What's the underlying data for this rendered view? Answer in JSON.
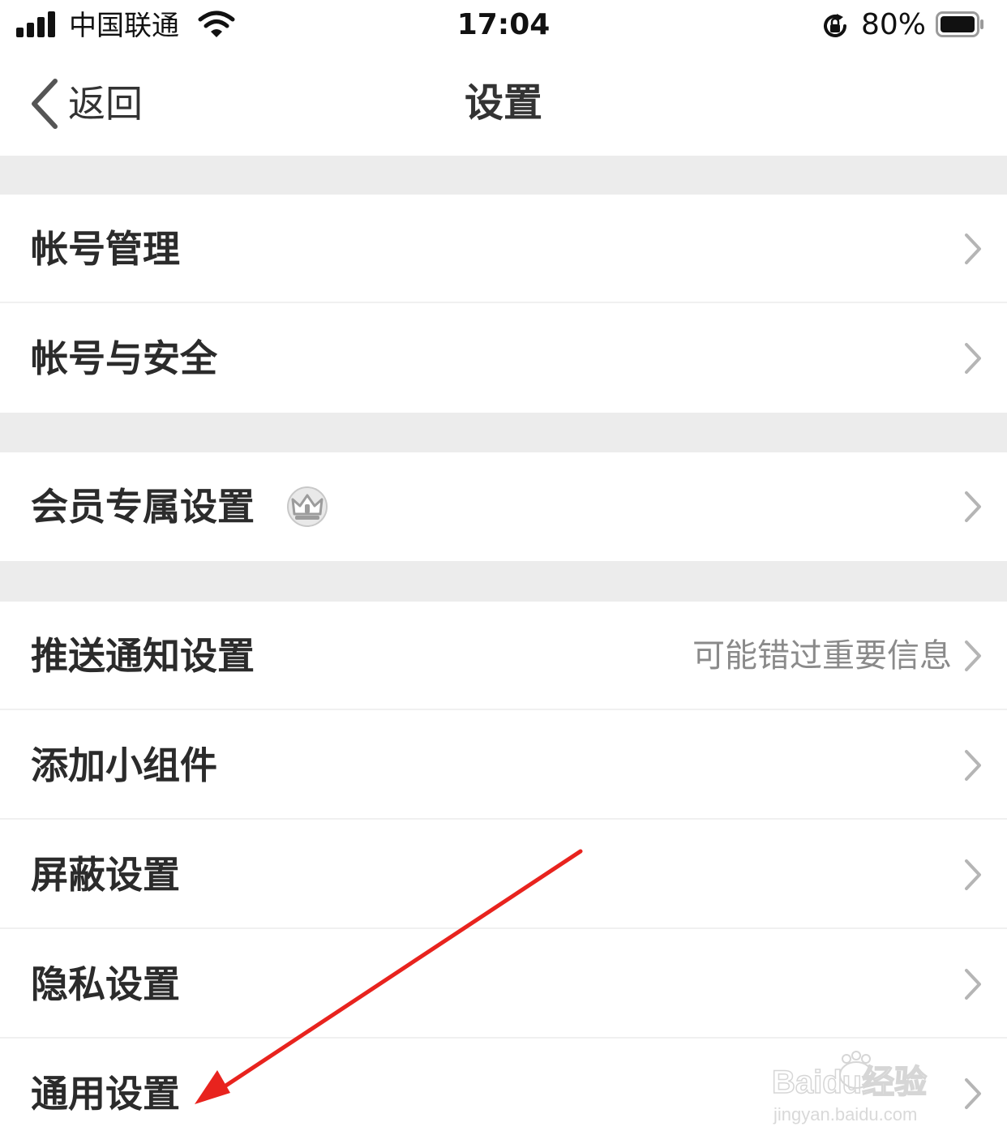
{
  "status_bar": {
    "carrier": "中国联通",
    "time": "17:04",
    "battery_percent": "80%",
    "battery_level": 0.8
  },
  "nav": {
    "back_label": "返回",
    "title": "设置"
  },
  "sections": [
    {
      "items": [
        {
          "label": "帐号管理"
        },
        {
          "label": "帐号与安全"
        }
      ]
    },
    {
      "items": [
        {
          "label": "会员专属设置",
          "icon": "crown-icon"
        }
      ]
    },
    {
      "items": [
        {
          "label": "推送通知设置",
          "value": "可能错过重要信息"
        },
        {
          "label": "添加小组件"
        },
        {
          "label": "屏蔽设置"
        },
        {
          "label": "隐私设置"
        },
        {
          "label": "通用设置"
        }
      ]
    }
  ],
  "colors": {
    "background": "#ffffff",
    "section_gap": "#ececec",
    "label": "#2b2b2b",
    "secondary": "#8a8a8a",
    "chevron": "#b5b5b5",
    "annotation_arrow": "#e8231e"
  },
  "watermark": {
    "text": "Baidu经验",
    "url": "jingyan.baidu.com"
  }
}
